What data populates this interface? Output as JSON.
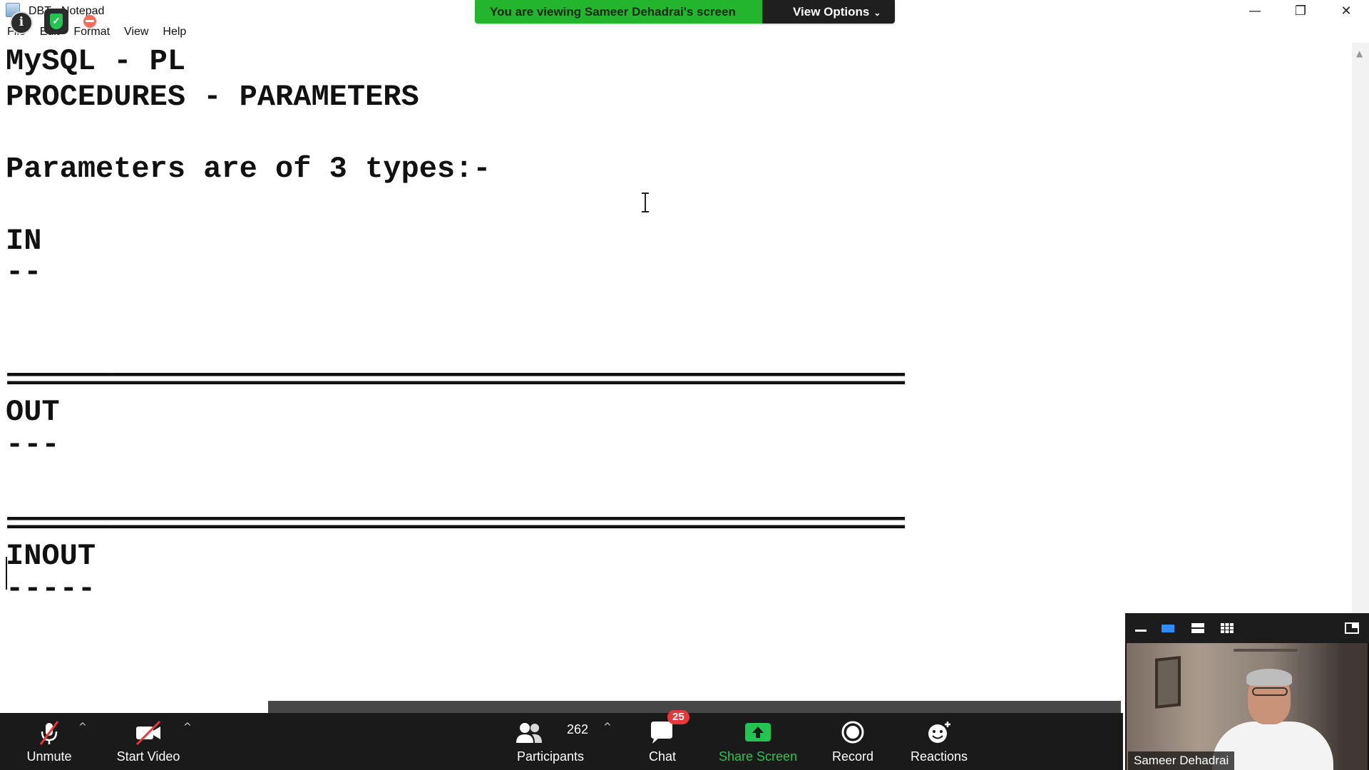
{
  "notepad": {
    "title": "DBT - Notepad",
    "menu": [
      "File",
      "Edit",
      "Format",
      "View",
      "Help"
    ],
    "lines": [
      "MySQL - PL",
      "PROCEDURES - PARAMETERS",
      "",
      "Parameters are of 3 types:-",
      "",
      "IN",
      "--",
      "",
      "",
      "=============================================================",
      "OUT",
      "---",
      "",
      "",
      "=============================================================",
      "INOUT",
      "-----"
    ]
  },
  "window_controls": {
    "minimize": "—",
    "restore": "❐",
    "close": "✕"
  },
  "share_banner": {
    "viewing_text": "You are viewing Sameer Dehadrai's screen",
    "view_options_label": "View Options",
    "colors": {
      "green": "#24b52e",
      "dark": "#1f1f1f"
    }
  },
  "zoom_toolbar": {
    "unmute_label": "Unmute",
    "start_video_label": "Start Video",
    "participants_label": "Participants",
    "participants_count": "262",
    "chat_label": "Chat",
    "chat_badge": "25",
    "share_screen_label": "Share Screen",
    "record_label": "Record",
    "reactions_label": "Reactions",
    "colors": {
      "background": "#1a1a1a",
      "share_green": "#23c552",
      "badge_red": "#e8383a"
    }
  },
  "video_panel": {
    "name": "Sameer Dehadrai"
  }
}
